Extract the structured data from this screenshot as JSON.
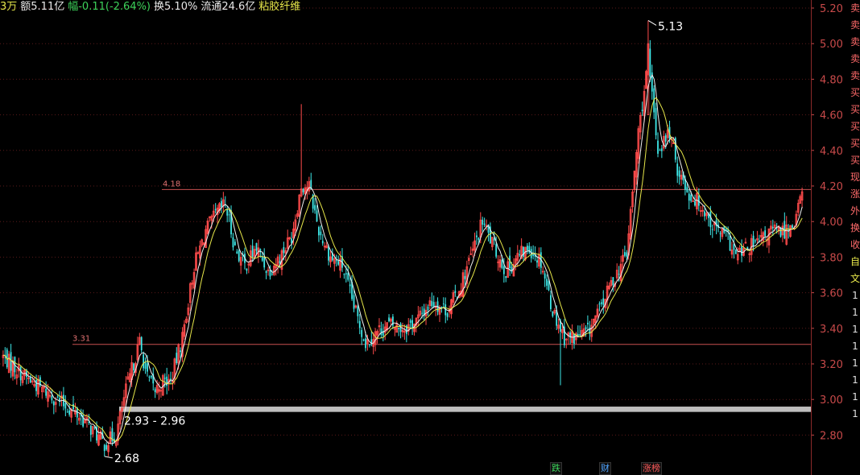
{
  "header": {
    "volume_fragment": "3万",
    "amount": "额5.11亿",
    "change": "幅-0.11(-2.64%)",
    "turnover": "换5.10%",
    "float_cap": "流通24.6亿",
    "concept": "粘胶纤维"
  },
  "colors": {
    "up": "#ff4b4b",
    "down": "#3ee8e8",
    "ma_white": "#f0f0f0",
    "ma_yellow": "#e6e64a",
    "grid": "#5a1a1a",
    "hline": "#c85050",
    "axis_text": "#c84a4a"
  },
  "chart_data": {
    "type": "candlestick",
    "ylim": [
      2.68,
      5.24
    ],
    "y_ticks": [
      "5.20",
      "5.00",
      "4.80",
      "4.60",
      "4.40",
      "4.20",
      "4.00",
      "3.80",
      "3.60",
      "3.40",
      "3.20",
      "3.00",
      "2.80"
    ],
    "annotations": {
      "high_label": "5.13",
      "low_label": "2.68",
      "gap_label": "2.93 - 2.96",
      "level_a_label": "4.18",
      "level_b_label": "3.31"
    },
    "levels": [
      4.18,
      3.31
    ],
    "gap_band": [
      2.93,
      2.96
    ],
    "high": 5.13,
    "low": 2.68,
    "key_points": [
      [
        0,
        3.24
      ],
      [
        12,
        3.12
      ],
      [
        25,
        3.02
      ],
      [
        40,
        2.9
      ],
      [
        52,
        2.75
      ],
      [
        58,
        2.8
      ],
      [
        63,
        3.05
      ],
      [
        70,
        3.32
      ],
      [
        74,
        3.12
      ],
      [
        78,
        3.05
      ],
      [
        82,
        3.1
      ],
      [
        86,
        3.1
      ],
      [
        92,
        3.35
      ],
      [
        98,
        3.75
      ],
      [
        104,
        3.95
      ],
      [
        110,
        4.05
      ],
      [
        114,
        4.1
      ],
      [
        119,
        3.85
      ],
      [
        124,
        3.75
      ],
      [
        130,
        3.85
      ],
      [
        136,
        3.72
      ],
      [
        142,
        3.8
      ],
      [
        148,
        3.92
      ],
      [
        153,
        4.2
      ],
      [
        157,
        4.2
      ],
      [
        162,
        3.95
      ],
      [
        168,
        3.8
      ],
      [
        174,
        3.75
      ],
      [
        180,
        3.52
      ],
      [
        186,
        3.32
      ],
      [
        192,
        3.38
      ],
      [
        198,
        3.42
      ],
      [
        206,
        3.4
      ],
      [
        212,
        3.44
      ],
      [
        220,
        3.55
      ],
      [
        228,
        3.5
      ],
      [
        234,
        3.62
      ],
      [
        240,
        3.8
      ],
      [
        246,
        4.0
      ],
      [
        252,
        3.85
      ],
      [
        258,
        3.72
      ],
      [
        264,
        3.8
      ],
      [
        270,
        3.85
      ],
      [
        276,
        3.78
      ],
      [
        282,
        3.5
      ],
      [
        288,
        3.35
      ],
      [
        294,
        3.35
      ],
      [
        300,
        3.38
      ],
      [
        306,
        3.5
      ],
      [
        312,
        3.65
      ],
      [
        320,
        3.82
      ],
      [
        326,
        4.5
      ],
      [
        331,
        4.9
      ],
      [
        336,
        4.4
      ],
      [
        342,
        4.5
      ],
      [
        346,
        4.3
      ],
      [
        352,
        4.15
      ],
      [
        358,
        4.1
      ],
      [
        364,
        3.98
      ],
      [
        372,
        3.9
      ],
      [
        376,
        3.8
      ],
      [
        382,
        3.85
      ],
      [
        388,
        3.88
      ],
      [
        394,
        3.95
      ],
      [
        400,
        3.94
      ],
      [
        406,
        4.0
      ],
      [
        410,
        4.16
      ]
    ],
    "legend_badges": [
      "跌",
      "财",
      "涨榜"
    ]
  },
  "side_tabs": [
    "卖",
    "卖",
    "卖",
    "卖",
    "卖",
    "买",
    "买",
    "买",
    "买",
    "买",
    "现",
    "涨",
    "外",
    "换",
    "收",
    "自",
    "文",
    "1",
    "1",
    "1",
    "1",
    "1",
    "1",
    "1",
    "1"
  ]
}
